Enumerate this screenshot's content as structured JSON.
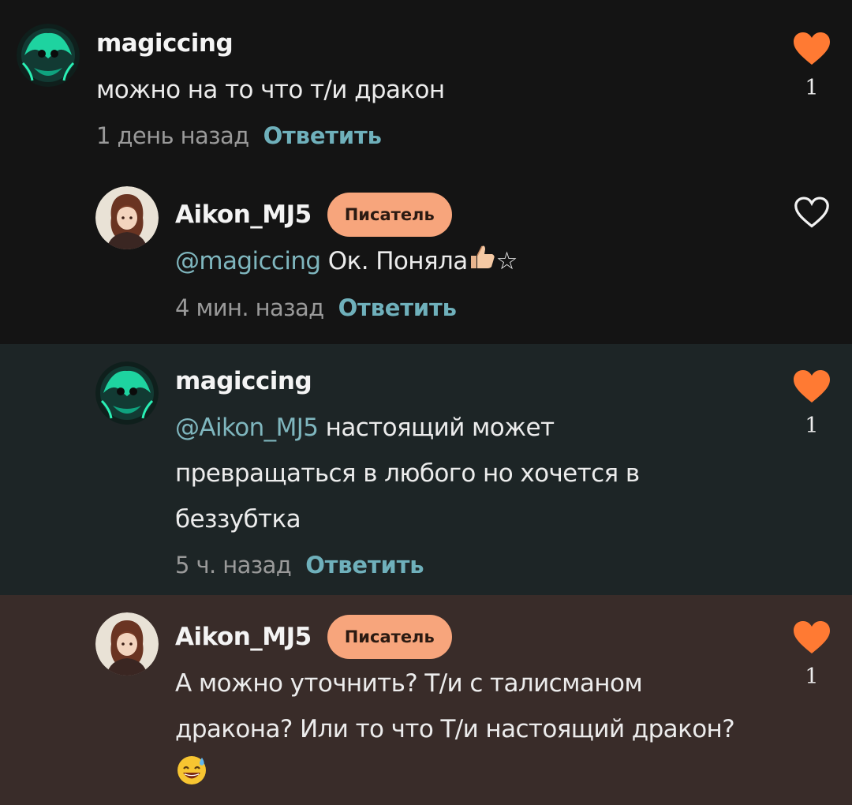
{
  "colors": {
    "accent_reply": "#6fb0bb",
    "mention": "#7fb6be",
    "like_active": "#ff7a33",
    "badge_bg": "#f7a57c"
  },
  "comments": [
    {
      "username": "magiccing",
      "badge": "",
      "mention": "",
      "text": "можно на то что т/и дракон",
      "time": "1 день назад",
      "reply_label": "Ответить",
      "liked": true,
      "like_count": "1",
      "avatar": "dark-green-creature-avatar"
    },
    {
      "username": "Aikon_MJ5",
      "badge": "Писатель",
      "mention": "@magiccing",
      "text": "Ок. Поняла",
      "emoji": [
        "thumbs-up-icon",
        "star-icon"
      ],
      "time": "4 мин. назад",
      "reply_label": "Ответить",
      "liked": false,
      "like_count": "",
      "avatar": "anime-girl-avatar"
    },
    {
      "username": "magiccing",
      "badge": "",
      "mention": "@Aikon_MJ5",
      "text_line1": "настоящий может",
      "text_line2": "превращаться в любого но хочется в",
      "text_line3": "беззубтка",
      "time": "5 ч. назад",
      "reply_label": "Ответить",
      "liked": true,
      "like_count": "1",
      "avatar": "dark-green-creature-avatar"
    },
    {
      "username": "Aikon_MJ5",
      "badge": "Писатель",
      "mention": "",
      "text_line1": "А можно уточнить? Т/и с талисманом",
      "text_line2": "дракона? Или то что Т/и настоящий дракон?",
      "emoji": [
        "sweat-smile-icon"
      ],
      "time": "",
      "reply_label": "",
      "liked": true,
      "like_count": "1",
      "avatar": "anime-girl-avatar"
    }
  ]
}
